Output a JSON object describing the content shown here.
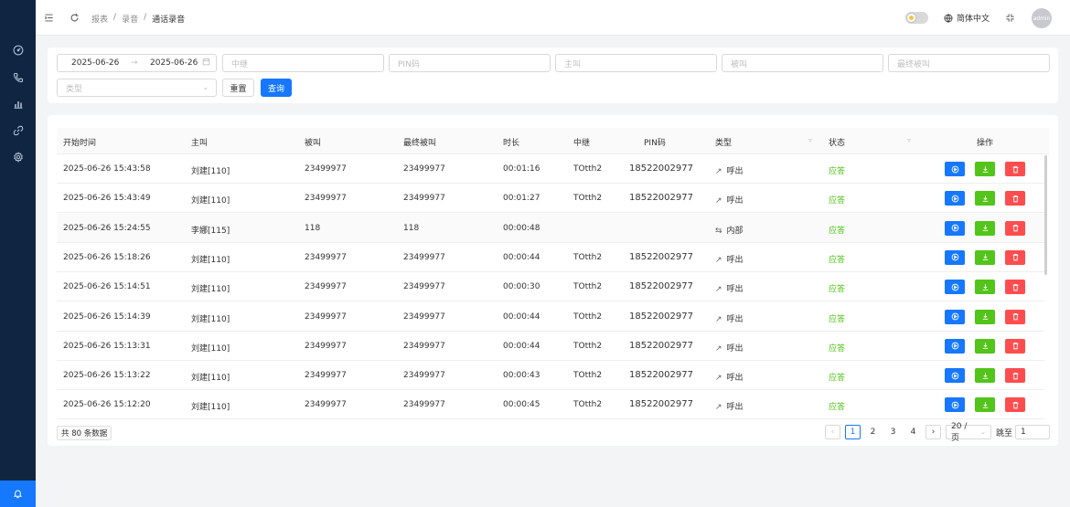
{
  "sidebar": {
    "icons": [
      "dashboard-icon",
      "phone-icon",
      "bar-chart-icon",
      "link-icon",
      "gear-icon"
    ],
    "bottom_icon": "bell-icon"
  },
  "header": {
    "breadcrumb": [
      "报表",
      "录音",
      "通话录音"
    ],
    "separator": "/",
    "language": "简体中文",
    "avatar_text": "admin"
  },
  "filters": {
    "date_start": "2025-06-26",
    "date_end": "2025-06-26",
    "date_arrow": "→",
    "placeholders": {
      "trunk": "中继",
      "pin": "PIN码",
      "caller": "主叫",
      "callee": "被叫",
      "final_callee": "最终被叫",
      "type": "类型"
    },
    "reset_label": "重置",
    "query_label": "查询"
  },
  "table": {
    "columns": [
      "开始时间",
      "主叫",
      "被叫",
      "最终被叫",
      "时长",
      "中继",
      "PIN码",
      "类型",
      "状态",
      "操作"
    ],
    "rows": [
      {
        "start": "2025-06-26 15:43:58",
        "caller": "刘建[110]",
        "callee": "23499977",
        "final": "23499977",
        "duration": "00:01:16",
        "trunk": "TOtth2",
        "pin": "18522002977",
        "type_icon": "↗",
        "type": "呼出",
        "status": "应答"
      },
      {
        "start": "2025-06-26 15:43:49",
        "caller": "刘建[110]",
        "callee": "23499977",
        "final": "23499977",
        "duration": "00:01:27",
        "trunk": "TOtth2",
        "pin": "18522002977",
        "type_icon": "↗",
        "type": "呼出",
        "status": "应答"
      },
      {
        "start": "2025-06-26 15:24:55",
        "caller": "李娜[115]",
        "callee": "118",
        "final": "118",
        "duration": "00:00:48",
        "trunk": "",
        "pin": "",
        "type_icon": "⇆",
        "type": "内部",
        "status": "应答"
      },
      {
        "start": "2025-06-26 15:18:26",
        "caller": "刘建[110]",
        "callee": "23499977",
        "final": "23499977",
        "duration": "00:00:44",
        "trunk": "TOtth2",
        "pin": "18522002977",
        "type_icon": "↗",
        "type": "呼出",
        "status": "应答"
      },
      {
        "start": "2025-06-26 15:14:51",
        "caller": "刘建[110]",
        "callee": "23499977",
        "final": "23499977",
        "duration": "00:00:30",
        "trunk": "TOtth2",
        "pin": "18522002977",
        "type_icon": "↗",
        "type": "呼出",
        "status": "应答"
      },
      {
        "start": "2025-06-26 15:14:39",
        "caller": "刘建[110]",
        "callee": "23499977",
        "final": "23499977",
        "duration": "00:00:44",
        "trunk": "TOtth2",
        "pin": "18522002977",
        "type_icon": "↗",
        "type": "呼出",
        "status": "应答"
      },
      {
        "start": "2025-06-26 15:13:31",
        "caller": "刘建[110]",
        "callee": "23499977",
        "final": "23499977",
        "duration": "00:00:44",
        "trunk": "TOtth2",
        "pin": "18522002977",
        "type_icon": "↗",
        "type": "呼出",
        "status": "应答"
      },
      {
        "start": "2025-06-26 15:13:22",
        "caller": "刘建[110]",
        "callee": "23499977",
        "final": "23499977",
        "duration": "00:00:43",
        "trunk": "TOtth2",
        "pin": "18522002977",
        "type_icon": "↗",
        "type": "呼出",
        "status": "应答"
      },
      {
        "start": "2025-06-26 15:12:20",
        "caller": "刘建[110]",
        "callee": "23499977",
        "final": "23499977",
        "duration": "00:00:45",
        "trunk": "TOtth2",
        "pin": "18522002977",
        "type_icon": "↗",
        "type": "呼出",
        "status": "应答"
      }
    ],
    "actions": [
      "play-icon",
      "download-icon",
      "trash-icon"
    ]
  },
  "pagination": {
    "total_label": "共 80 条数据",
    "prev": "‹",
    "next": "›",
    "pages": [
      "1",
      "2",
      "3",
      "4"
    ],
    "current_page": "1",
    "page_size": "20 / 页",
    "jump_label": "跳至",
    "jump_value": "1"
  },
  "colors": {
    "sidebar_bg": "#0f2542",
    "accent": "#1677ff",
    "success": "#52c41a",
    "danger": "#ff4d4f",
    "status_text": "#52c41a"
  }
}
